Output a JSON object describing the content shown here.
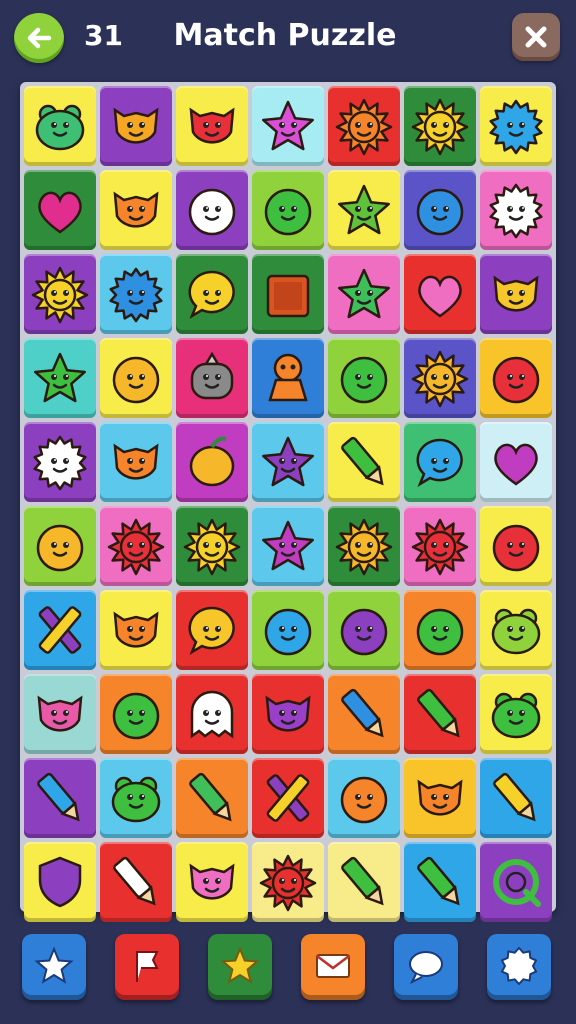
{
  "header": {
    "moves": "31",
    "title": "Match Puzzle"
  },
  "board": {
    "columns": 7,
    "rows": 10,
    "tiles": [
      {
        "bg": "#f8ec4a",
        "icon": "frog",
        "color": "#3fbf73"
      },
      {
        "bg": "#8c3fbf",
        "icon": "cat",
        "color": "#f5a623"
      },
      {
        "bg": "#f8ec4a",
        "icon": "cat",
        "color": "#e8303a"
      },
      {
        "bg": "#a7ecf2",
        "icon": "star",
        "color": "#d94fd6"
      },
      {
        "bg": "#e8302e",
        "icon": "sun",
        "color": "#f5842a"
      },
      {
        "bg": "#2e8c3a",
        "icon": "sun",
        "color": "#f6d12a"
      },
      {
        "bg": "#f8ec4a",
        "icon": "splat",
        "color": "#2fa6e8"
      },
      {
        "bg": "#2e8c3a",
        "icon": "heart",
        "color": "#e02d8e"
      },
      {
        "bg": "#f8ec4a",
        "icon": "cat",
        "color": "#f5842a"
      },
      {
        "bg": "#8c3fbf",
        "icon": "blob",
        "color": "#ffffff"
      },
      {
        "bg": "#8fd23c",
        "icon": "blob",
        "color": "#3fbf3f"
      },
      {
        "bg": "#f8ec4a",
        "icon": "star",
        "color": "#5fc23a"
      },
      {
        "bg": "#5a54c8",
        "icon": "rocket",
        "color": "#2f8fe0"
      },
      {
        "bg": "#f06ec2",
        "icon": "splat",
        "color": "#ffffff"
      },
      {
        "bg": "#8c3fbf",
        "icon": "sun",
        "color": "#f6d12a"
      },
      {
        "bg": "#5cc8ec",
        "icon": "splat",
        "color": "#2f8fe0"
      },
      {
        "bg": "#2e8c3a",
        "icon": "bubble",
        "color": "#f6d12a"
      },
      {
        "bg": "#2e8c3a",
        "icon": "square",
        "color": "#d9541e"
      },
      {
        "bg": "#f06ec2",
        "icon": "star",
        "color": "#3fbf5a"
      },
      {
        "bg": "#e8302e",
        "icon": "heart",
        "color": "#f06ec2"
      },
      {
        "bg": "#8c3fbf",
        "icon": "cat",
        "color": "#f6c62a"
      },
      {
        "bg": "#4ed0c8",
        "icon": "star",
        "color": "#3fbf3f"
      },
      {
        "bg": "#f8ec4a",
        "icon": "blob",
        "color": "#f6b72a"
      },
      {
        "bg": "#e8307a",
        "icon": "robot",
        "color": "#8a8a8a"
      },
      {
        "bg": "#2f7fd8",
        "icon": "bear",
        "color": "#f5842a"
      },
      {
        "bg": "#8fd23c",
        "icon": "blob",
        "color": "#3fbf3f"
      },
      {
        "bg": "#5a54c8",
        "icon": "sun",
        "color": "#f6b72a"
      },
      {
        "bg": "#f8c42a",
        "icon": "blob",
        "color": "#e8303a"
      },
      {
        "bg": "#8c3fbf",
        "icon": "splat",
        "color": "#ffffff"
      },
      {
        "bg": "#5cc8ec",
        "icon": "cat",
        "color": "#f5842a"
      },
      {
        "bg": "#c03cc0",
        "icon": "fruit",
        "color": "#f6b72a"
      },
      {
        "bg": "#5cc8ec",
        "icon": "star",
        "color": "#8c3fbf"
      },
      {
        "bg": "#f8ec4a",
        "icon": "pencil",
        "color": "#3fbf3f"
      },
      {
        "bg": "#3fbf73",
        "icon": "bubble",
        "color": "#2fa6e8"
      },
      {
        "bg": "#cfeff6",
        "icon": "heart",
        "color": "#c03cc0"
      },
      {
        "bg": "#8fd23c",
        "icon": "blob",
        "color": "#f6b72a"
      },
      {
        "bg": "#f06ec2",
        "icon": "sun",
        "color": "#e8303a"
      },
      {
        "bg": "#2e8c3a",
        "icon": "sun",
        "color": "#f6d12a"
      },
      {
        "bg": "#5cc8ec",
        "icon": "star",
        "color": "#c03cc0"
      },
      {
        "bg": "#2e8c3a",
        "icon": "sun",
        "color": "#f6b72a"
      },
      {
        "bg": "#f06ec2",
        "icon": "sun",
        "color": "#e8303a"
      },
      {
        "bg": "#f8ec4a",
        "icon": "blob",
        "color": "#e8303a"
      },
      {
        "bg": "#2fa6e8",
        "icon": "crossed",
        "color": "#8c3fbf"
      },
      {
        "bg": "#f8ec4a",
        "icon": "cat",
        "color": "#f5842a"
      },
      {
        "bg": "#e8302e",
        "icon": "bubble",
        "color": "#f6c62a"
      },
      {
        "bg": "#8fd23c",
        "icon": "blob",
        "color": "#2fa6e8"
      },
      {
        "bg": "#8fd23c",
        "icon": "blob",
        "color": "#8c3fbf"
      },
      {
        "bg": "#f5842a",
        "icon": "blob",
        "color": "#3fbf3f"
      },
      {
        "bg": "#f8ec4a",
        "icon": "frog",
        "color": "#8fd23c"
      },
      {
        "bg": "#9ad8d4",
        "icon": "cat",
        "color": "#e85aa8"
      },
      {
        "bg": "#f5842a",
        "icon": "blob",
        "color": "#3fbf3f"
      },
      {
        "bg": "#e8302e",
        "icon": "ghost",
        "color": "#ffffff"
      },
      {
        "bg": "#e8302e",
        "icon": "cat",
        "color": "#9a3fc8"
      },
      {
        "bg": "#f5842a",
        "icon": "pencil",
        "color": "#2f8fe0"
      },
      {
        "bg": "#e8302e",
        "icon": "pencil",
        "color": "#3fbf3f"
      },
      {
        "bg": "#f8ec4a",
        "icon": "frog",
        "color": "#3fbf3f"
      },
      {
        "bg": "#8c3fbf",
        "icon": "pencil",
        "color": "#2fa6e8"
      },
      {
        "bg": "#5cc8ec",
        "icon": "frog",
        "color": "#3fbf3f"
      },
      {
        "bg": "#f5842a",
        "icon": "pencil",
        "color": "#3fbf5a"
      },
      {
        "bg": "#e8302e",
        "icon": "crossed",
        "color": "#8c3fbf"
      },
      {
        "bg": "#5cc8ec",
        "icon": "blob",
        "color": "#f5842a"
      },
      {
        "bg": "#f8c42a",
        "icon": "cat",
        "color": "#f5842a"
      },
      {
        "bg": "#2fa6e8",
        "icon": "pencil",
        "color": "#f6d12a"
      },
      {
        "bg": "#f8ec4a",
        "icon": "shield",
        "color": "#8c3fbf"
      },
      {
        "bg": "#e8302e",
        "icon": "pencil",
        "color": "#ffffff"
      },
      {
        "bg": "#f8ec4a",
        "icon": "cat",
        "color": "#f06ec2"
      },
      {
        "bg": "#f8ec8a",
        "icon": "sun",
        "color": "#e8302e"
      },
      {
        "bg": "#f8ec8a",
        "icon": "pencil",
        "color": "#3fbf3f"
      },
      {
        "bg": "#2fa6e8",
        "icon": "pencil",
        "color": "#3fbf3f"
      },
      {
        "bg": "#8c3fbf",
        "icon": "target",
        "color": "#3fbf3f"
      }
    ]
  },
  "powerups": [
    {
      "icon": "star-icon",
      "bg": "#2f7fd8"
    },
    {
      "icon": "flag-icon",
      "bg": "#e8302e"
    },
    {
      "icon": "gold-star-icon",
      "bg": "#2e8c3a"
    },
    {
      "icon": "envelope-icon",
      "bg": "#f5842a"
    },
    {
      "icon": "chat-icon",
      "bg": "#2f7fd8"
    },
    {
      "icon": "cloud-icon",
      "bg": "#2f7fd8"
    }
  ]
}
